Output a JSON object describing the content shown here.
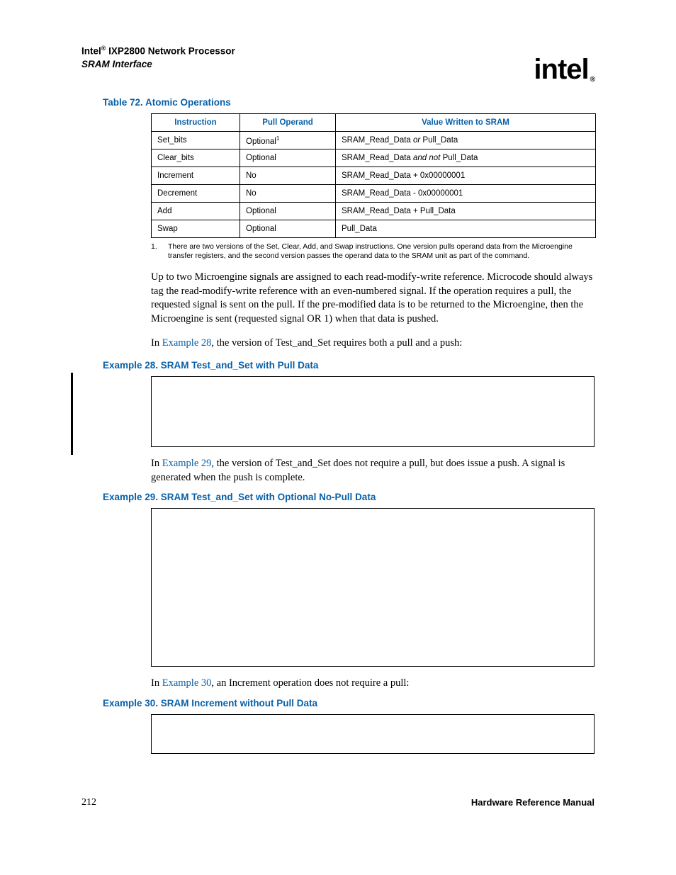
{
  "header": {
    "brand": "Intel",
    "reg": "®",
    "product": " IXP2800 Network Processor",
    "subtitle": "SRAM Interface",
    "logo_text": "intel",
    "logo_sub": "®"
  },
  "table_caption": "Table 72.  Atomic Operations",
  "chart_data": {
    "type": "table",
    "columns": [
      "Instruction",
      "Pull Operand",
      "Value Written to SRAM"
    ],
    "rows": [
      {
        "instruction": "Set_bits",
        "pull_operand": "Optional",
        "pull_sup": "1",
        "value_pre": "SRAM_Read_Data ",
        "value_italic": "or",
        "value_post": " Pull_Data"
      },
      {
        "instruction": "Clear_bits",
        "pull_operand": "Optional",
        "pull_sup": "",
        "value_pre": "SRAM_Read_Data ",
        "value_italic": "and not",
        "value_post": " Pull_Data"
      },
      {
        "instruction": "Increment",
        "pull_operand": "No",
        "pull_sup": "",
        "value_pre": "SRAM_Read_Data + 0x00000001",
        "value_italic": "",
        "value_post": ""
      },
      {
        "instruction": "Decrement",
        "pull_operand": "No",
        "pull_sup": "",
        "value_pre": "SRAM_Read_Data - 0x00000001",
        "value_italic": "",
        "value_post": ""
      },
      {
        "instruction": "Add",
        "pull_operand": "Optional",
        "pull_sup": "",
        "value_pre": "SRAM_Read_Data + Pull_Data",
        "value_italic": "",
        "value_post": ""
      },
      {
        "instruction": "Swap",
        "pull_operand": "Optional",
        "pull_sup": "",
        "value_pre": "Pull_Data",
        "value_italic": "",
        "value_post": ""
      }
    ]
  },
  "footnote": {
    "num": "1.",
    "text": "There are two versions of the Set, Clear, Add, and Swap instructions. One version pulls operand data from the Microengine transfer registers, and the second version passes the operand data to the SRAM unit as part of the command."
  },
  "para1": "Up to two Microengine signals are assigned to each read-modify-write reference. Microcode should always tag the read-modify-write reference with an even-numbered signal. If the operation requires a pull, the requested signal is sent on the pull. If the pre-modified data is to be returned to the Microengine, then the Microengine is sent (requested signal OR 1) when that data is pushed.",
  "para2_pre": "In ",
  "para2_link": "Example 28",
  "para2_post": ", the version of Test_and_Set requires both a pull and a push:",
  "example28_caption": "Example 28. SRAM Test_and_Set with Pull Data",
  "para3_pre": "In ",
  "para3_link": "Example 29",
  "para3_post": ", the version of Test_and_Set does not require a pull, but does issue a push. A signal is generated when the push is complete.",
  "example29_caption": "Example 29. SRAM Test_and_Set with Optional No-Pull Data",
  "para4_pre": "In ",
  "para4_link": "Example 30",
  "para4_post": ", an Increment operation does not require a pull:",
  "example30_caption": "Example 30. SRAM Increment without Pull Data",
  "footer": {
    "page": "212",
    "manual": "Hardware Reference Manual"
  }
}
